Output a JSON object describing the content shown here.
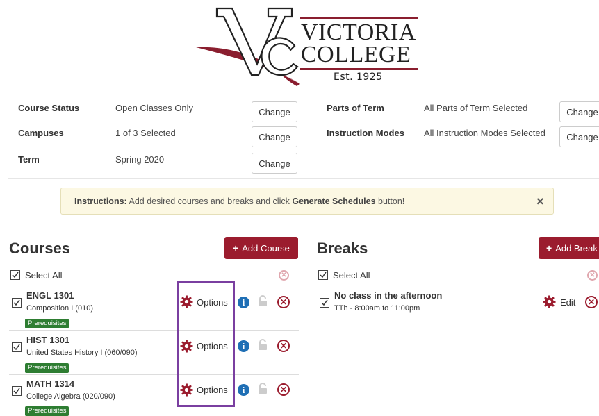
{
  "logo": {
    "initials": "VC",
    "line1": "VICTORIA",
    "line2": "COLLEGE",
    "established": "Est. 1925",
    "brand_color": "#8a1e2f"
  },
  "filters": {
    "course_status": {
      "label": "Course Status",
      "value": "Open Classes Only",
      "button": "Change"
    },
    "campuses": {
      "label": "Campuses",
      "value": "1 of 3 Selected",
      "button": "Change"
    },
    "term": {
      "label": "Term",
      "value": "Spring 2020",
      "button": "Change"
    },
    "parts_of_term": {
      "label": "Parts of Term",
      "value": "All Parts of Term Selected",
      "button": "Change"
    },
    "instruction_modes": {
      "label": "Instruction Modes",
      "value": "All Instruction Modes Selected",
      "button": "Change"
    }
  },
  "instructions": {
    "prefix": "Instructions:",
    "text_before": " Add desired courses and breaks and click ",
    "emphasis": "Generate Schedules",
    "text_after": " button!",
    "close_icon": "×"
  },
  "courses": {
    "heading": "Courses",
    "add_button": "Add Course",
    "select_all": "Select All",
    "items": [
      {
        "code": "ENGL 1301",
        "name": "Composition I (010)",
        "badge": "Prerequisites",
        "options": "Options"
      },
      {
        "code": "HIST 1301",
        "name": "United States History I (060/090)",
        "badge": "Prerequisites",
        "options": "Options"
      },
      {
        "code": "MATH 1314",
        "name": "College Algebra (020/090)",
        "badge": "Prerequisites",
        "options": "Options"
      }
    ]
  },
  "breaks": {
    "heading": "Breaks",
    "add_button": "Add Break",
    "select_all": "Select All",
    "items": [
      {
        "title": "No class in the afternoon",
        "detail": "TTh - 8:00am to 11:00pm",
        "edit": "Edit"
      }
    ]
  },
  "colors": {
    "accent_red": "#9b1c2e",
    "info_blue": "#1f6fb5",
    "badge_green": "#2e7d32",
    "highlight_purple": "#7a3fa0",
    "alert_bg": "#fcf8e3"
  }
}
